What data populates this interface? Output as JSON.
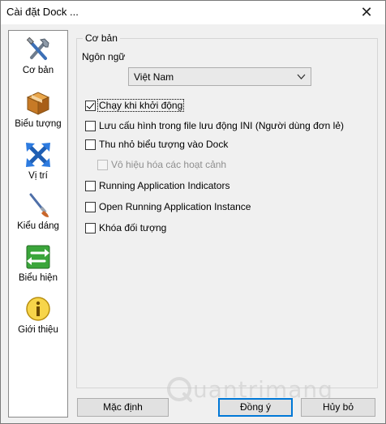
{
  "window": {
    "title": "Cài đặt Dock ...",
    "close_glyph": "✕"
  },
  "sidebar": {
    "items": [
      {
        "label": "Cơ bản",
        "icon": "tools-icon"
      },
      {
        "label": "Biểu tượng",
        "icon": "box-icon"
      },
      {
        "label": "Vị trí",
        "icon": "arrows-icon"
      },
      {
        "label": "Kiểu dáng",
        "icon": "brush-icon"
      },
      {
        "label": "Biểu hiện",
        "icon": "exchange-icon"
      },
      {
        "label": "Giới thiệu",
        "icon": "info-icon"
      }
    ]
  },
  "panel": {
    "group_title": "Cơ bản",
    "language_label": "Ngôn ngữ",
    "language_value": "Việt Nam",
    "options": [
      {
        "label": "Chạy khi khởi động",
        "checked": true,
        "disabled": false
      },
      {
        "label": "Lưu cấu hình trong file lưu động INI (Người dùng đơn lẻ)",
        "checked": false,
        "disabled": false
      },
      {
        "label": "Thu nhỏ biểu tượng vào Dock",
        "checked": false,
        "disabled": false
      },
      {
        "label": "Vô hiệu hóa các hoạt cảnh",
        "checked": false,
        "disabled": true
      },
      {
        "label": "Running Application Indicators",
        "checked": false,
        "disabled": false
      },
      {
        "label": "Open Running Application Instance",
        "checked": false,
        "disabled": false
      },
      {
        "label": "Khóa đối tượng",
        "checked": false,
        "disabled": false
      }
    ]
  },
  "buttons": {
    "default_label": "Mặc định",
    "ok_label": "Đồng ý",
    "cancel_label": "Hủy bỏ"
  },
  "watermark": {
    "text": "uantrimang"
  },
  "colors": {
    "accent": "#0078d7",
    "window_bg": "#f0f0f0",
    "checkbox_disabled": "#bcbcbc"
  }
}
